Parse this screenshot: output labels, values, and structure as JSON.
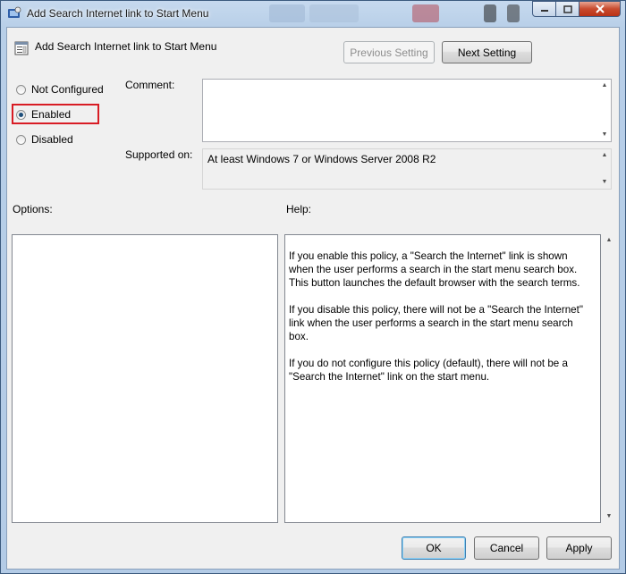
{
  "window": {
    "title": "Add Search Internet link to Start Menu"
  },
  "header": {
    "policy_title": "Add Search Internet link to Start Menu",
    "prev_label": "Previous Setting",
    "next_label": "Next Setting"
  },
  "state": {
    "options": [
      {
        "label": "Not Configured",
        "checked": false
      },
      {
        "label": "Enabled",
        "checked": true
      },
      {
        "label": "Disabled",
        "checked": false
      }
    ]
  },
  "fields": {
    "comment_label": "Comment:",
    "comment_value": "",
    "supported_label": "Supported on:",
    "supported_value": "At least Windows 7 or Windows Server 2008 R2"
  },
  "panels": {
    "options_label": "Options:",
    "help_label": "Help:",
    "help_paragraphs": [
      "If you enable this policy, a \"Search the Internet\" link is shown when the user performs a search in the start menu search box. This button launches the default browser with the search terms.",
      "If you disable this policy, there will not be a \"Search the Internet\" link when the user performs a search in the start menu search box.",
      "If you do not configure this policy (default), there will not be a \"Search the Internet\" link on the start menu."
    ]
  },
  "footer": {
    "ok_label": "OK",
    "cancel_label": "Cancel",
    "apply_label": "Apply"
  },
  "colors": {
    "highlight_border": "#d81c24",
    "client_bg": "#f0f0f0"
  }
}
